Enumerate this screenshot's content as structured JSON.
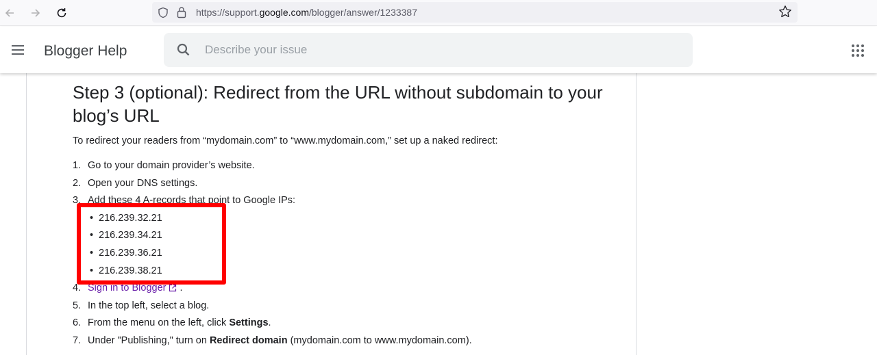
{
  "browser": {
    "url_prefix": "https://support.",
    "url_domain": "google.com",
    "url_path": "/blogger/answer/1233387"
  },
  "header": {
    "title": "Blogger Help",
    "search_placeholder": "Describe your issue"
  },
  "article": {
    "heading": "Step 3 (optional): Redirect from the URL without subdomain to your blog’s URL",
    "intro": "To redirect your readers from “mydomain.com” to “www.mydomain.com,” set up a naked redirect:",
    "steps": {
      "s1": {
        "num": "1.",
        "text": "Go to your domain provider’s website."
      },
      "s2": {
        "num": "2.",
        "text": "Open your DNS settings."
      },
      "s3": {
        "num": "3.",
        "text": "Add these 4 A-records that point to Google IPs:"
      },
      "s4": {
        "num": "4.",
        "link": "Sign in to Blogger",
        "suffix": "."
      },
      "s5": {
        "num": "5.",
        "text": "In the top left, select a blog."
      },
      "s6": {
        "num": "6.",
        "before": "From the menu on the left, click ",
        "bold": "Settings",
        "after": "."
      },
      "s7": {
        "num": "7.",
        "before": "Under \"Publishing,\" turn on ",
        "bold": "Redirect domain",
        "after": " (mydomain.com to www.mydomain.com)."
      }
    },
    "ips": [
      "216.239.32.21",
      "216.239.34.21",
      "216.239.36.21",
      "216.239.38.21"
    ]
  },
  "colors": {
    "highlight": "#ff0000",
    "link": "#681da8"
  }
}
